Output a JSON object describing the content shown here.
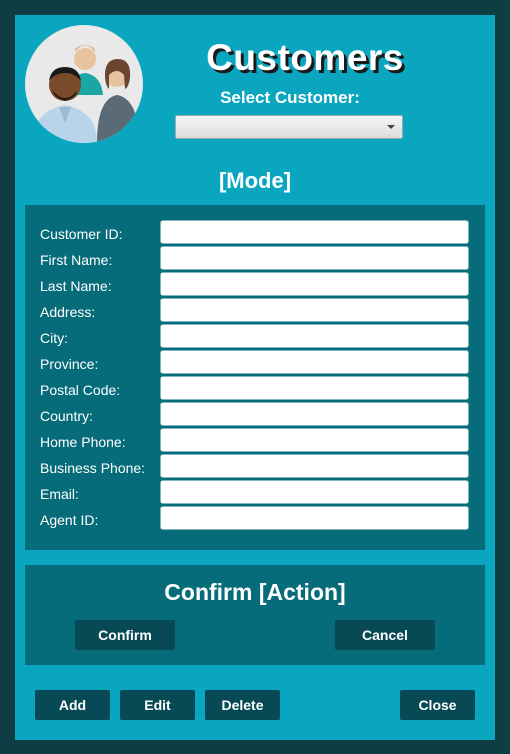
{
  "header": {
    "title": "Customers",
    "select_label": "Select Customer:",
    "select_value": ""
  },
  "mode_label": "[Mode]",
  "form": {
    "fields": [
      {
        "label": "Customer ID:",
        "value": ""
      },
      {
        "label": "First Name:",
        "value": ""
      },
      {
        "label": "Last Name:",
        "value": ""
      },
      {
        "label": "Address:",
        "value": ""
      },
      {
        "label": "City:",
        "value": ""
      },
      {
        "label": "Province:",
        "value": ""
      },
      {
        "label": "Postal Code:",
        "value": ""
      },
      {
        "label": "Country:",
        "value": ""
      },
      {
        "label": "Home Phone:",
        "value": ""
      },
      {
        "label": "Business Phone:",
        "value": ""
      },
      {
        "label": "Email:",
        "value": ""
      },
      {
        "label": "Agent ID:",
        "value": ""
      }
    ]
  },
  "confirm_panel": {
    "title": "Confirm [Action]",
    "confirm_label": "Confirm",
    "cancel_label": "Cancel"
  },
  "footer": {
    "add_label": "Add",
    "edit_label": "Edit",
    "delete_label": "Delete",
    "close_label": "Close"
  },
  "colors": {
    "background": "#0f3d44",
    "window": "#0aa6bf",
    "panel": "#066c7a",
    "button": "#074a55"
  },
  "icons": {
    "avatar": "customers-group-icon",
    "dropdown": "chevron-down-icon"
  }
}
